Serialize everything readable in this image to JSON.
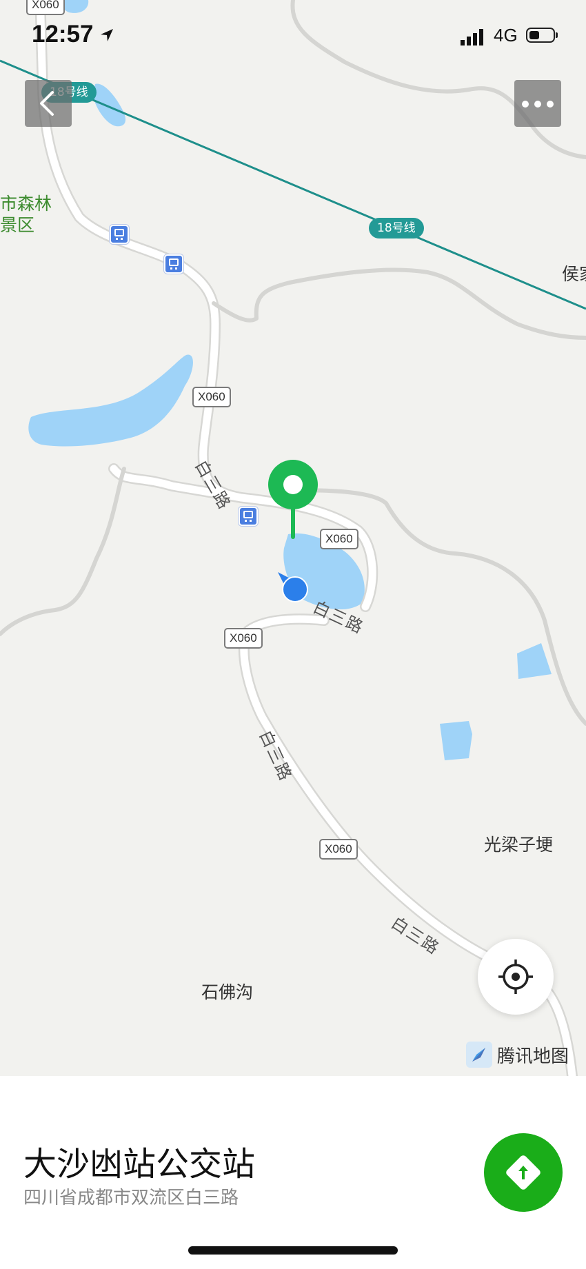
{
  "status_bar": {
    "time": "12:57",
    "network": "4G"
  },
  "map": {
    "road_shields": [
      "X060",
      "X060",
      "X060",
      "X060",
      "X060"
    ],
    "metro_labels": [
      "18号线",
      "18号线"
    ],
    "road_names": [
      "白三路",
      "白三路",
      "白三路",
      "白三路"
    ],
    "places": {
      "forest_line1": "市森林",
      "forest_line2": "景区",
      "hou_jia": "侯家",
      "guang_liang": "光梁子埂",
      "shi_fo": "石佛沟"
    },
    "brand": "腾讯地图",
    "icons": [
      "chevron-left-icon",
      "more-dots-icon",
      "crosshair-icon",
      "bus-stop-icon",
      "pin-icon",
      "compass-icon",
      "navigation-arrow-icon",
      "route-icon"
    ],
    "colors": {
      "map_bg": "#f2f2ef",
      "water": "#9fd3f8",
      "metro": "#239a96",
      "pin": "#1db954",
      "user_dot": "#2b7fea",
      "route_button": "#1aad19"
    }
  },
  "poi": {
    "title": "大沙凼站公交站",
    "address": "四川省成都市双流区白三路"
  }
}
